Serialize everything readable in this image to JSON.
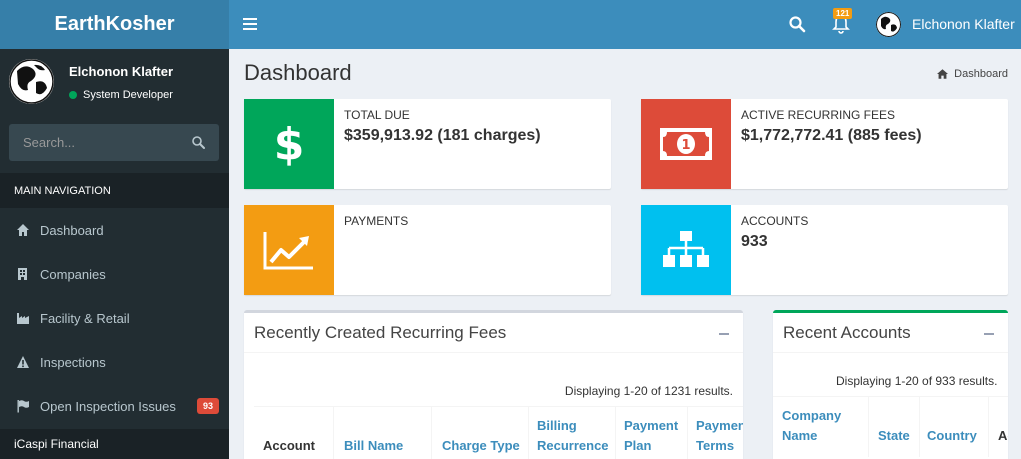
{
  "header": {
    "brand": "EarthKosher",
    "notification_count": "121",
    "user_name": "Elchonon Klafter"
  },
  "sidebar": {
    "user_name": "Elchonon Klafter",
    "user_role": "System Developer",
    "search_placeholder": "Search...",
    "nav_header": "MAIN NAVIGATION",
    "items": [
      {
        "label": "Dashboard",
        "icon": "home-icon"
      },
      {
        "label": "Companies",
        "icon": "building-icon"
      },
      {
        "label": "Facility & Retail",
        "icon": "industry-icon"
      },
      {
        "label": "Inspections",
        "icon": "warning-icon"
      },
      {
        "label": "Open Inspection Issues",
        "icon": "flag-icon",
        "badge": "93"
      }
    ],
    "section": "iCaspi Financial"
  },
  "page": {
    "title": "Dashboard",
    "breadcrumb": "Dashboard"
  },
  "info_boxes": [
    {
      "label": "TOTAL DUE",
      "value": "$359,913.92 (181 charges)",
      "color": "#00a65a",
      "icon": "dollar-icon"
    },
    {
      "label": "ACTIVE RECURRING FEES",
      "value": "$1,772,772.41 (885 fees)",
      "color": "#dd4b39",
      "icon": "money-icon"
    },
    {
      "label": "PAYMENTS",
      "value": "",
      "color": "#f39c12",
      "icon": "area-chart-icon"
    },
    {
      "label": "ACCOUNTS",
      "value": "933",
      "color": "#00c0ef",
      "icon": "sitemap-icon"
    }
  ],
  "recurring_fees": {
    "title": "Recently Created Recurring Fees",
    "summary": "Displaying 1-20 of 1231 results.",
    "columns": [
      "Account",
      "Bill Name",
      "Charge Type",
      "Billing Recurrence",
      "Payment Plan",
      "Payment Terms"
    ]
  },
  "recent_accounts": {
    "title": "Recent Accounts",
    "summary": "Displaying 1-20 of 933 results.",
    "columns": [
      "Company Name",
      "State",
      "Country",
      "Ac"
    ]
  }
}
